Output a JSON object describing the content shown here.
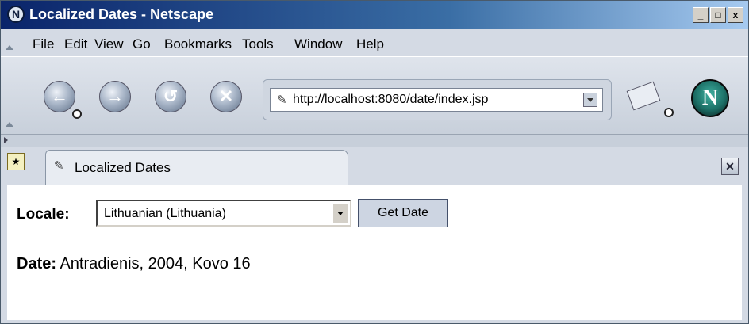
{
  "window": {
    "title": "Localized Dates - Netscape",
    "app_icon": "N"
  },
  "window_controls": [
    "_",
    "□",
    "x"
  ],
  "menu": [
    "File",
    "Edit",
    "View",
    "Go",
    "Bookmarks",
    "Tools",
    "Window",
    "Help"
  ],
  "toolbar": {
    "back_icon": "back-arrow-icon",
    "url": "http://localhost:8080/date/index.jsp",
    "logo_letter": "N"
  },
  "tab": {
    "label": "Localized Dates"
  },
  "form": {
    "locale_label": "Locale:",
    "locale_selected": "Lithuanian (Lithuania)",
    "button_label": "Get Date"
  },
  "result": {
    "date_label": "Date:",
    "date_value": "Antradienis, 2004, Kovo 16"
  }
}
